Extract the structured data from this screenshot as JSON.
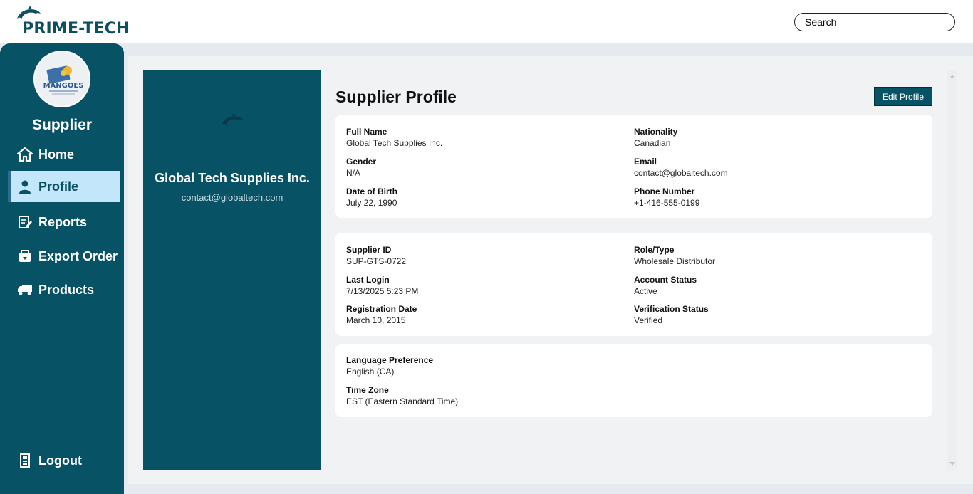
{
  "brand": {
    "name": "PRIME-TECH",
    "logo_icon": "dolphin-icon"
  },
  "search": {
    "placeholder": "Search"
  },
  "sidebar": {
    "role": "Supplier",
    "avatar_text": "MANGOES",
    "items": [
      {
        "label": "Home",
        "icon": "home-icon"
      },
      {
        "label": "Profile",
        "icon": "user-icon",
        "active": true
      },
      {
        "label": "Reports",
        "icon": "report-icon"
      },
      {
        "label": "Export Order",
        "icon": "export-icon"
      },
      {
        "label": "Products",
        "icon": "truck-icon"
      }
    ],
    "logout": {
      "label": "Logout",
      "icon": "logout-icon"
    }
  },
  "profile_card": {
    "company": "Global Tech Supplies Inc.",
    "email": "contact@globaltech.com"
  },
  "main": {
    "title": "Supplier Profile",
    "edit_label": "Edit Profile",
    "personal": [
      {
        "label": "Full Name",
        "value": "Global Tech Supplies Inc."
      },
      {
        "label": "Gender",
        "value": "N/A"
      },
      {
        "label": "Date of Birth",
        "value": "July 22, 1990"
      },
      {
        "label": "Nationality",
        "value": "Canadian"
      },
      {
        "label": "Email",
        "value": "contact@globaltech.com"
      },
      {
        "label": "Phone Number",
        "value": "+1-416-555-0199"
      }
    ],
    "account": [
      {
        "label": "Supplier ID",
        "value": "SUP-GTS-0722"
      },
      {
        "label": "Last Login",
        "value": "7/13/2025 5:23 PM"
      },
      {
        "label": "Registration Date",
        "value": "March 10, 2015"
      },
      {
        "label": "Role/Type",
        "value": "Wholesale Distributor"
      },
      {
        "label": "Account Status",
        "value": "Active"
      },
      {
        "label": "Verification Status",
        "value": "Verified"
      }
    ],
    "preferences": [
      {
        "label": "Language Preference",
        "value": "English (CA)"
      },
      {
        "label": "Time Zone",
        "value": "EST (Eastern Standard Time)"
      }
    ]
  },
  "colors": {
    "primary": "#075265",
    "active_nav": "#c3e6fa",
    "background": "#f1f2f4"
  }
}
